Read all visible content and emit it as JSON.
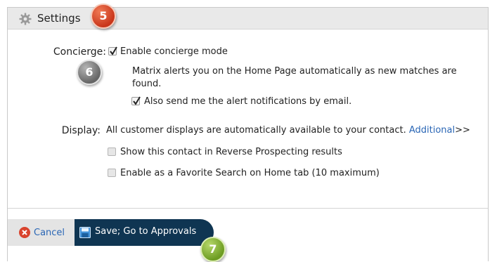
{
  "header": {
    "title": "Settings"
  },
  "badges": {
    "b5": "5",
    "b6": "6",
    "b7": "7"
  },
  "concierge": {
    "label": "Concierge:",
    "enable_label": "Enable concierge mode",
    "enable_checked": true,
    "description_line1": "Matrix alerts you on the Home Page automatically as new matches are",
    "description_line2": "found.",
    "email_label": "Also send me the alert notifications by email.",
    "email_checked": true
  },
  "display": {
    "label": "Display:",
    "text": "All customer displays are automatically available to your contact.",
    "link": "Additional",
    "link_suffix": ">>",
    "reverse_label": "Show this contact in Reverse Prospecting results",
    "reverse_checked": false,
    "favorite_label": "Enable as a Favorite Search on Home tab (10 maximum)",
    "favorite_checked": false
  },
  "buttons": {
    "cancel_label": "Cancel",
    "save_label": "Save; Go to Approvals"
  },
  "colors": {
    "header_bg": "#e9e9e9",
    "link": "#2a66b5",
    "save_bg": "#0f3552",
    "badge_red": "#c9361b",
    "badge_green": "#6d9c22",
    "badge_gray": "#666666"
  }
}
